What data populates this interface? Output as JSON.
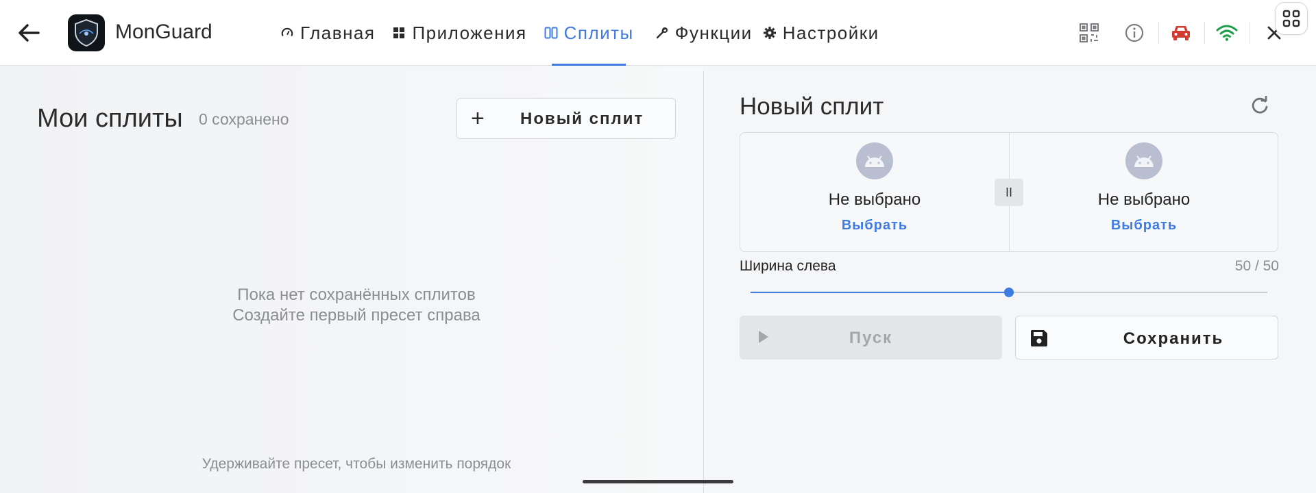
{
  "app": {
    "name": "MonGuard"
  },
  "nav": {
    "tabs": [
      {
        "label": "Главная",
        "icon": "speedometer-icon",
        "active": false
      },
      {
        "label": "Приложения",
        "icon": "grid-icon",
        "active": false
      },
      {
        "label": "Сплиты",
        "icon": "split-columns-icon",
        "active": true
      },
      {
        "label": "Функции",
        "icon": "wrench-icon",
        "active": false
      },
      {
        "label": "Настройки",
        "icon": "gear-icon",
        "active": false
      }
    ]
  },
  "toolbar_icons": [
    "qr-code-icon",
    "info-icon",
    "car-icon",
    "wifi-icon",
    "close-icon",
    "apps-grid-icon"
  ],
  "colors": {
    "accent": "#3f7be0",
    "car": "#d23b2f",
    "wifi": "#1e9e4a"
  },
  "my_splits": {
    "title": "Мои сплиты",
    "saved_count": "0 сохранено",
    "new_button": "Новый сплит",
    "empty_line1": "Пока нет сохранённых сплитов",
    "empty_line2": "Создайте первый пресет справа",
    "hint": "Удерживайте пресет, чтобы изменить порядок"
  },
  "new_split": {
    "title": "Новый сплит",
    "left_slot": {
      "name": "Не выбрано",
      "action": "Выбрать"
    },
    "right_slot": {
      "name": "Не выбрано",
      "action": "Выбрать"
    },
    "handle_label": "II",
    "width_label": "Ширина слева",
    "width_value": "50 / 50",
    "left_width_fraction": 0.5,
    "run_label": "Пуск",
    "save_label": "Сохранить"
  }
}
